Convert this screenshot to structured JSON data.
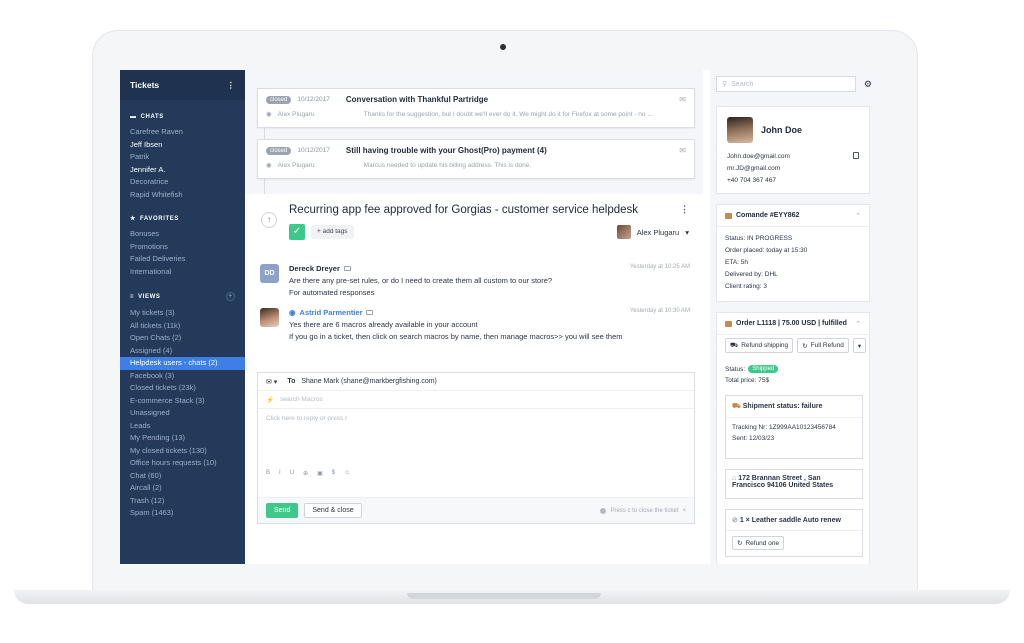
{
  "sidebar": {
    "title": "Tickets",
    "chats_label": "CHATS",
    "chats": [
      "Carefree Raven",
      "Jeff Ibsen",
      "Patrik",
      "Jennifer A.",
      "Decoratrice",
      "Rapid Whitefish"
    ],
    "favorites_label": "FAVORITES",
    "favorites": [
      "Bonuses",
      "Promotions",
      "Failed Deliveries",
      "International"
    ],
    "views_label": "VIEWS",
    "views": [
      "My tickets (3)",
      "All tickets (11k)",
      "Open Chats (2)",
      "Assigned (4)",
      "Helpdesk users - chats (2)",
      "Facebook (3)",
      "Closed tickets (23k)",
      "E-commerce Stack (3)",
      "Unassigned",
      "Leads",
      "My Pending (13)",
      "My closed tickets (130)",
      "Office hours requests (10)",
      "Chat (60)",
      "Aircall (2)",
      "Trash (12)",
      "Spam (1463)"
    ]
  },
  "ticket_list": [
    {
      "status": "closed",
      "date": "10/12/2017",
      "title": "Conversation with Thankful Partridge",
      "author": "Alex Plugaru",
      "preview": "Thanks for the suggestion, but I doubt we'll ever do it. We might do it for Firefox at some point - no ..."
    },
    {
      "status": "closed",
      "date": "10/12/2017",
      "title": "Still having trouble with your Ghost(Pro) payment (4)",
      "author": "Alex Plugaru",
      "preview": "Marcus needed to update his billing address. This is done."
    }
  ],
  "ticket": {
    "title": "Recurring app fee approved for Gorgias - customer service helpdesk",
    "add_tags": "+ add tags",
    "assignee": "Alex Plugaru",
    "messages": [
      {
        "initials": "DD",
        "name": "Dereck Dreyer",
        "time": "Yesterday at 10:25 AM",
        "lines": [
          "Are there any pre-set rules, or do I need to create them all custom to our store?",
          "For automated responses"
        ]
      },
      {
        "name": "Astrid Parmentier",
        "time": "Yesterday at 10:30 AM",
        "lines": [
          "Yes there are 6 macros already available in your account",
          "If you go in a ticket, then click on search macros by name, then manage macros>> you will see them"
        ]
      }
    ]
  },
  "reply": {
    "to_label": "To",
    "to_value": "Shane Mark (shane@markbergfishing.com)",
    "macros_placeholder": "search Macros",
    "body_placeholder": "Click here to reply or press r",
    "format_buttons": [
      "B",
      "I",
      "U",
      "⊕",
      "▣",
      "$",
      "☺"
    ],
    "send": "Send",
    "send_close": "Send & close",
    "hint": "Press c to close the ticket"
  },
  "customer": {
    "search_placeholder": "Search",
    "name": "John Doe",
    "email": "John.doe@gmail.com",
    "alt_email": "mr.JD@gmail.com",
    "phone": "+40 704 367 467"
  },
  "command": {
    "title": "Comande #EYY862",
    "fields": [
      {
        "k": "Status:",
        "v": "IN PROGRESS"
      },
      {
        "k": "Order placed:",
        "v": "today at 15:30"
      },
      {
        "k": "ETA:",
        "v": "5h"
      },
      {
        "k": "Delivered by:",
        "v": "DHL"
      },
      {
        "k": "Client rating:",
        "v": "3"
      }
    ]
  },
  "order": {
    "title": "Order L1118 | 75.00 USD | fulfilled",
    "refund_shipping": "Refund shipping",
    "full_refund": "Full Refund",
    "status_label": "Status:",
    "status_badge": "Shipped",
    "total_price": "Total price: 75$",
    "shipment_title": "Shipment status: failure",
    "tracking": "Tracking Nr: 1Z999AA10123456784",
    "sent": "Sent: 12/03/23",
    "address_line1": "172 Brannan Street , San",
    "address_line2": "Francisco 94106 United States",
    "item": "1 × Leather saddle Auto renew",
    "refund_one": "Refund one"
  },
  "colors": {
    "sidebar": "#243a5a",
    "active": "#3d7fe6",
    "green": "#3ec98b"
  }
}
